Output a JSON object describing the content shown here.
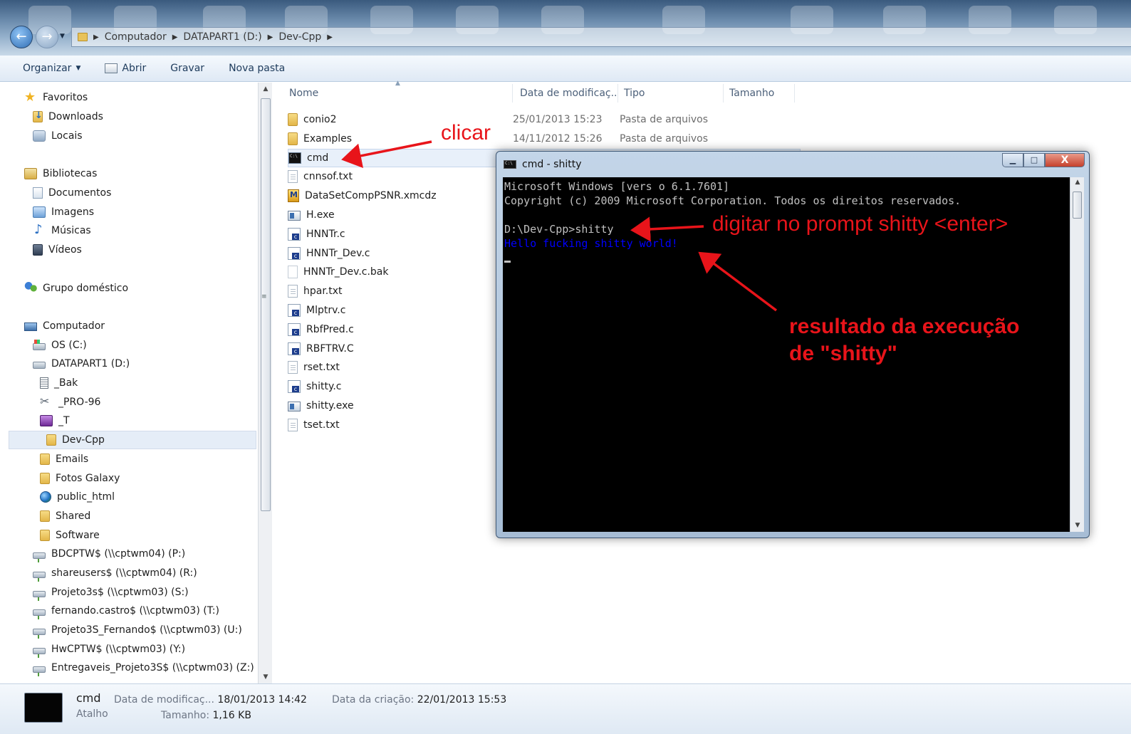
{
  "address": {
    "crumbs": [
      "Computador",
      "DATAPART1 (D:)",
      "Dev-Cpp"
    ]
  },
  "toolbar": {
    "organize": "Organizar",
    "open": "Abrir",
    "burn": "Gravar",
    "new_folder": "Nova pasta"
  },
  "nav": {
    "favorites": "Favoritos",
    "downloads": "Downloads",
    "places": "Locais",
    "libraries": "Bibliotecas",
    "documents": "Documentos",
    "images": "Imagens",
    "music": "Músicas",
    "videos": "Vídeos",
    "homegroup": "Grupo doméstico",
    "computer": "Computador",
    "os_c": "OS (C:)",
    "datapart": "DATAPART1 (D:)",
    "bak": "_Bak",
    "pro96": "_PRO-96",
    "t": "_T",
    "devcpp": "Dev-Cpp",
    "emails": "Emails",
    "fotos": "Fotos Galaxy",
    "public_html": "public_html",
    "shared": "Shared",
    "software": "Software",
    "net1": "BDCPTW$ (\\\\cptwm04) (P:)",
    "net2": "shareusers$ (\\\\cptwm04) (R:)",
    "net3": "Projeto3s$ (\\\\cptwm03) (S:)",
    "net4": "fernando.castro$ (\\\\cptwm03) (T:)",
    "net5": "Projeto3S_Fernando$ (\\\\cptwm03) (U:)",
    "net6": "HwCPTW$ (\\\\cptwm03) (Y:)",
    "net7": "Entregaveis_Projeto3S$ (\\\\cptwm03) (Z:)"
  },
  "columns": {
    "name": "Nome",
    "date": "Data de modificaç...",
    "type": "Tipo",
    "size": "Tamanho"
  },
  "files": [
    {
      "name": "conio2",
      "date": "25/01/2013 15:23",
      "type": "Pasta de arquivos",
      "icon": "folder-icon"
    },
    {
      "name": "Examples",
      "date": "14/11/2012 15:26",
      "type": "Pasta de arquivos",
      "icon": "folder-icon"
    },
    {
      "name": "cmd",
      "date": "",
      "type": "",
      "icon": "cmd-shortcut-icon"
    },
    {
      "name": "cnnsof.txt",
      "date": "",
      "type": "",
      "icon": "text-file-icon"
    },
    {
      "name": "DataSetCompPSNR.xmcdz",
      "date": "",
      "type": "",
      "icon": "mathcad-file-icon"
    },
    {
      "name": "H.exe",
      "date": "",
      "type": "",
      "icon": "exe-file-icon"
    },
    {
      "name": "HNNTr.c",
      "date": "",
      "type": "",
      "icon": "c-file-icon"
    },
    {
      "name": "HNNTr_Dev.c",
      "date": "",
      "type": "",
      "icon": "c-file-icon"
    },
    {
      "name": "HNNTr_Dev.c.bak",
      "date": "",
      "type": "",
      "icon": "bak-file-icon"
    },
    {
      "name": "hpar.txt",
      "date": "",
      "type": "",
      "icon": "text-file-icon"
    },
    {
      "name": "Mlptrv.c",
      "date": "",
      "type": "",
      "icon": "c-file-icon"
    },
    {
      "name": "RbfPred.c",
      "date": "",
      "type": "",
      "icon": "c-file-icon"
    },
    {
      "name": "RBFTRV.C",
      "date": "",
      "type": "",
      "icon": "c-file-icon"
    },
    {
      "name": "rset.txt",
      "date": "",
      "type": "",
      "icon": "text-file-icon"
    },
    {
      "name": "shitty.c",
      "date": "",
      "type": "",
      "icon": "c-file-icon"
    },
    {
      "name": "shitty.exe",
      "date": "",
      "type": "",
      "icon": "exe-file-icon"
    },
    {
      "name": "tset.txt",
      "date": "",
      "type": "",
      "icon": "text-file-icon"
    }
  ],
  "cmd": {
    "title": "cmd - shitty",
    "line1": "Microsoft Windows [vers o 6.1.7601]",
    "line2": "Copyright (c) 2009 Microsoft Corporation. Todos os direitos reservados.",
    "line3": "D:\\Dev-Cpp>shitty",
    "line4": "Hello fucking shitty world!",
    "close": "X"
  },
  "annotations": {
    "click": "clicar",
    "prompt": "digitar no prompt shitty <enter>",
    "result1": "resultado da execução",
    "result2": "de \"shitty\""
  },
  "details": {
    "name": "cmd",
    "kind": "Atalho",
    "modified_label": "Data de modificaç...",
    "modified_value": "18/01/2013 14:42",
    "size_label": "Tamanho:",
    "size_value": "1,16 KB",
    "created_label": "Data da criação:",
    "created_value": "22/01/2013 15:53"
  },
  "colors": {
    "annotation": "#e8141a",
    "console_bg": "#000000",
    "console_output": "#0000ff"
  }
}
